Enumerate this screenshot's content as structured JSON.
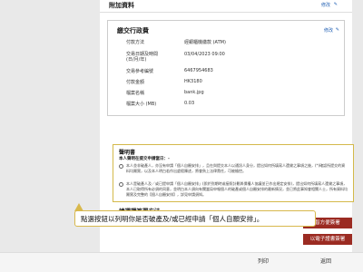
{
  "attachments": {
    "title": "附加資料",
    "edit": "修改"
  },
  "transaction": {
    "title": "繳交行政費",
    "edit": "修改",
    "rows": [
      {
        "label": "付款方法",
        "value": "經銀櫃機繳款 (ATM)"
      },
      {
        "label": "交易日期及時間\n(日/月/年)",
        "value": "03/04/2023 09:00"
      },
      {
        "label": "交易參考編號",
        "value": "6467954683"
      },
      {
        "label": "付款金額",
        "value": "HK3180"
      },
      {
        "label": "檔案名稱",
        "value": "bank.jpg"
      },
      {
        "label": "檔案大小 (MB)",
        "value": "0.03"
      }
    ]
  },
  "declaration": {
    "title": "聲明書",
    "subtitle": "本人聲明在提交申請當日：-",
    "options": [
      "本人並非破產人，亦沒有申請「個人自願安排」，且在與提交本人以通訊人身分，提出如何所填寫人還貸之事項之後，(*)確認所提交的資料均屬實，以及本人明白若作出虛假陳述，將會負上法律責任，可被檢控。",
      "本人是破產人及／或已提申請「個人自願安排」(即於到期時或接照計劃與債權人協議並已作出規定安排)，提出如何所填寫人還貸之事項，本人已取得所有必須的同意，並明白本人須向有關當局申報個人的破產或個人自願安排的最新情況，並已將此事知會相關人士，所有資料均屬實及完整的【個人自願安排】，詳見申請須知。"
    ]
  },
  "method": {
    "title": "請選擇簽署方法"
  },
  "buttons": {
    "sign_iam": "智方便簽署",
    "sign_esign": "以電子證書簽署",
    "print": "列印",
    "back": "返回"
  },
  "tip": {
    "text": "點選按鈕以列明你是否破產及/或已經申請「個人自願安排」。"
  }
}
